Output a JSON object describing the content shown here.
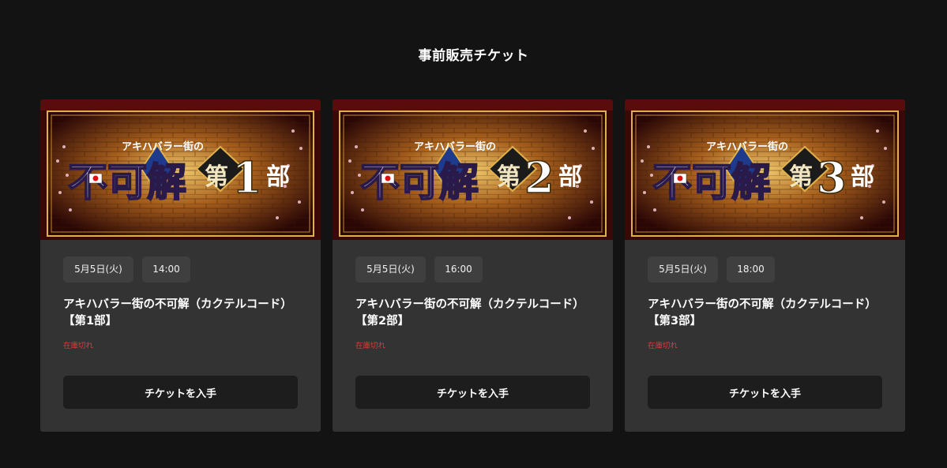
{
  "page": {
    "section_title": "事前販売チケット"
  },
  "cards": [
    {
      "banner": {
        "logo_top": "アキハバラー街の",
        "logo_main": "不可解",
        "part_prefix": "第",
        "part_number": "1",
        "part_suffix": "部"
      },
      "date": "5月5日(火)",
      "time": "14:00",
      "title_line1": "アキハバラー街の不可解（カクテルコード）",
      "title_line2": "【第1部】",
      "status": "在庫切れ",
      "button_label": "チケットを入手"
    },
    {
      "banner": {
        "logo_top": "アキハバラー街の",
        "logo_main": "不可解",
        "part_prefix": "第",
        "part_number": "2",
        "part_suffix": "部"
      },
      "date": "5月5日(火)",
      "time": "16:00",
      "title_line1": "アキハバラー街の不可解（カクテルコード）",
      "title_line2": "【第2部】",
      "status": "在庫切れ",
      "button_label": "チケットを入手"
    },
    {
      "banner": {
        "logo_top": "アキハバラー街の",
        "logo_main": "不可解",
        "part_prefix": "第",
        "part_number": "3",
        "part_suffix": "部"
      },
      "date": "5月5日(火)",
      "time": "18:00",
      "title_line1": "アキハバラー街の不可解（カクテルコード）",
      "title_line2": "【第3部】",
      "status": "在庫切れ",
      "button_label": "チケットを入手"
    }
  ],
  "colors": {
    "background": "#131313",
    "card": "#333333",
    "chip": "#3f3f3f",
    "button": "#1d1d1d",
    "sold_out": "#e53935",
    "banner_gold": "#d9a441"
  }
}
